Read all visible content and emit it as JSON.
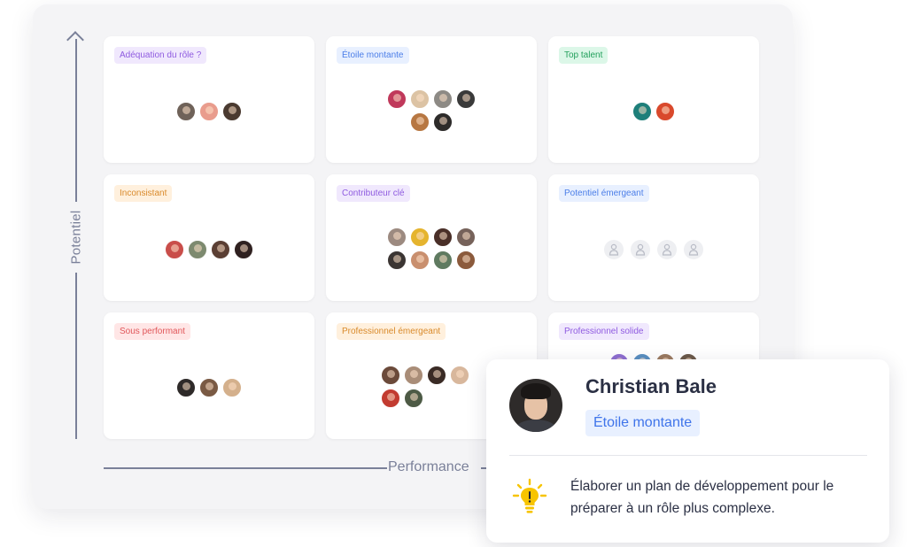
{
  "axes": {
    "y_label": "Potentiel",
    "x_label": "Performance"
  },
  "colors": {
    "purple_tag_bg": "#f0e8fd",
    "purple_tag_text": "#8f5be0",
    "blue_tag_bg": "#e8f0ff",
    "blue_tag_text": "#4b7ee8",
    "green_tag_bg": "#dcf7e8",
    "green_tag_text": "#23a05c",
    "orange_tag_bg": "#fff0dd",
    "orange_tag_text": "#d98a2b",
    "red_tag_bg": "#ffe6e6",
    "red_tag_text": "#e0575a"
  },
  "grid": [
    {
      "label": "Adéquation du rôle ?",
      "color": "purple",
      "avatars": 3
    },
    {
      "label": "Étoile montante",
      "color": "blue",
      "avatars": 6
    },
    {
      "label": "Top talent",
      "color": "green",
      "avatars": 2
    },
    {
      "label": "Inconsistant",
      "color": "orange",
      "avatars": 4
    },
    {
      "label": "Contributeur clé",
      "color": "purple",
      "avatars": 8
    },
    {
      "label": "Potentiel émergeant",
      "color": "blue",
      "avatars": 0,
      "placeholders": 4
    },
    {
      "label": "Sous performant",
      "color": "red",
      "avatars": 3
    },
    {
      "label": "Professionnel émergeant",
      "color": "orange",
      "avatars": 6
    },
    {
      "label": "Professionnel solide",
      "color": "purple",
      "avatars": 4
    }
  ],
  "card": {
    "name": "Christian Bale",
    "tag": "Étoile montante",
    "icon": "lightbulb-icon",
    "recommendation": "Élaborer un plan de développement pour le préparer à un rôle plus complexe."
  }
}
